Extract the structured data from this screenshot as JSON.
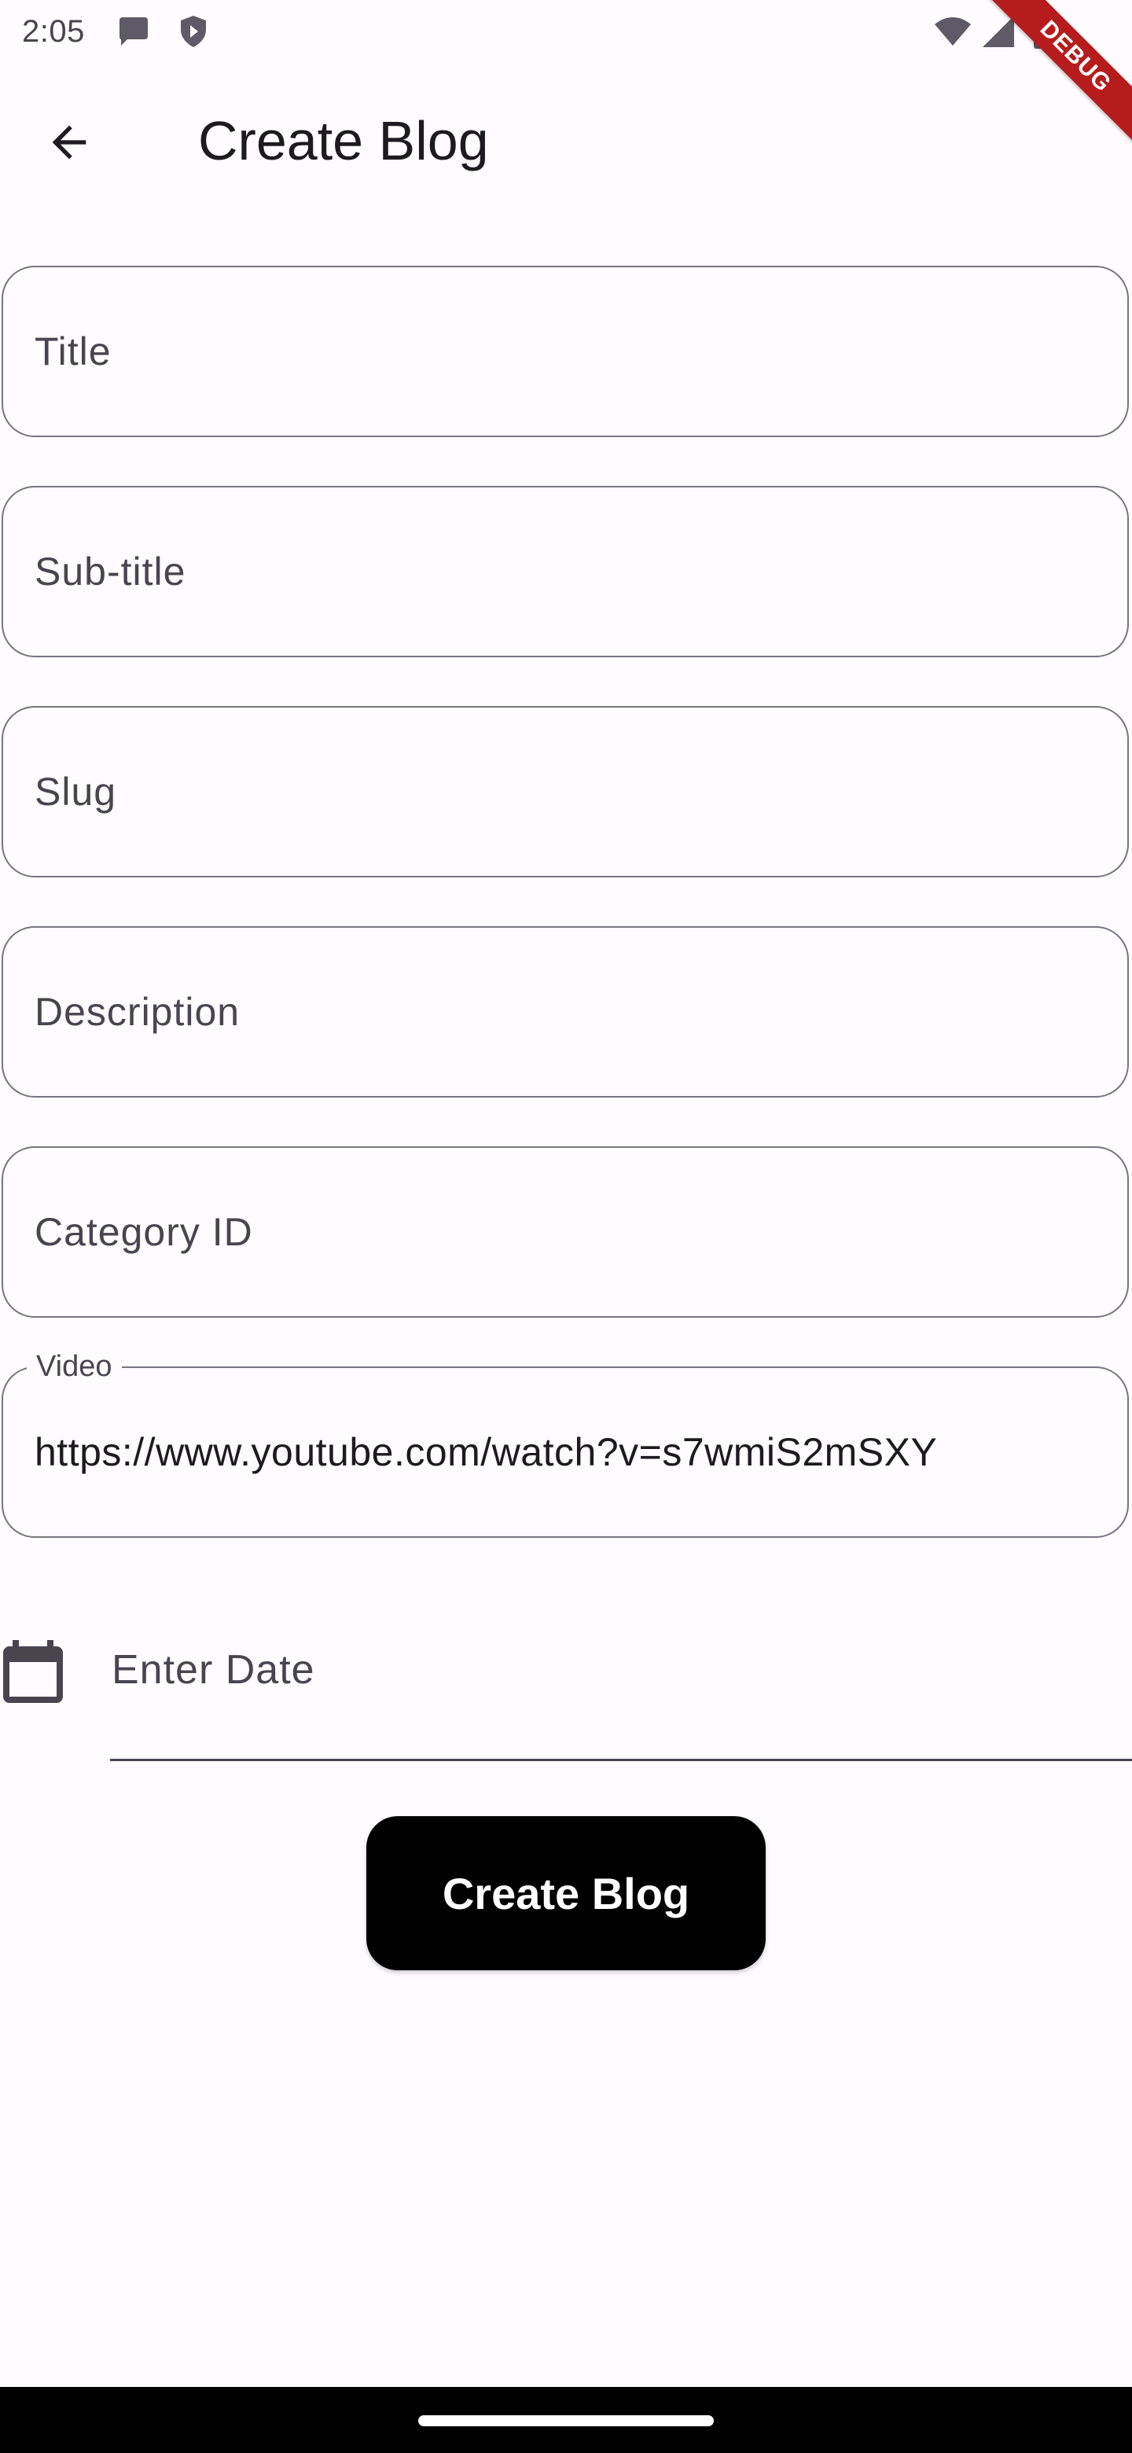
{
  "status_bar": {
    "time": "2:05",
    "icons": [
      "chat-bubble-icon",
      "shield-icon",
      "wifi-icon",
      "signal-icon",
      "battery-icon"
    ]
  },
  "debug_banner": "DEBUG",
  "app_bar": {
    "title": "Create Blog",
    "back_icon": "arrow-back-icon"
  },
  "form": {
    "title": {
      "placeholder": "Title",
      "value": ""
    },
    "subtitle": {
      "placeholder": "Sub-title",
      "value": ""
    },
    "slug": {
      "placeholder": "Slug",
      "value": ""
    },
    "description": {
      "placeholder": "Description",
      "value": ""
    },
    "category_id": {
      "placeholder": "Category ID",
      "value": ""
    },
    "video": {
      "label": "Video",
      "value": "https://www.youtube.com/watch?v=s7wmiS2mSXY"
    },
    "date": {
      "placeholder": "Enter Date",
      "icon": "calendar-icon"
    }
  },
  "submit_button": {
    "label": "Create Blog"
  },
  "colors": {
    "background": "#fffbfe",
    "outline": "#79747e",
    "button": "#000000",
    "debug_banner": "#b71c1c"
  }
}
